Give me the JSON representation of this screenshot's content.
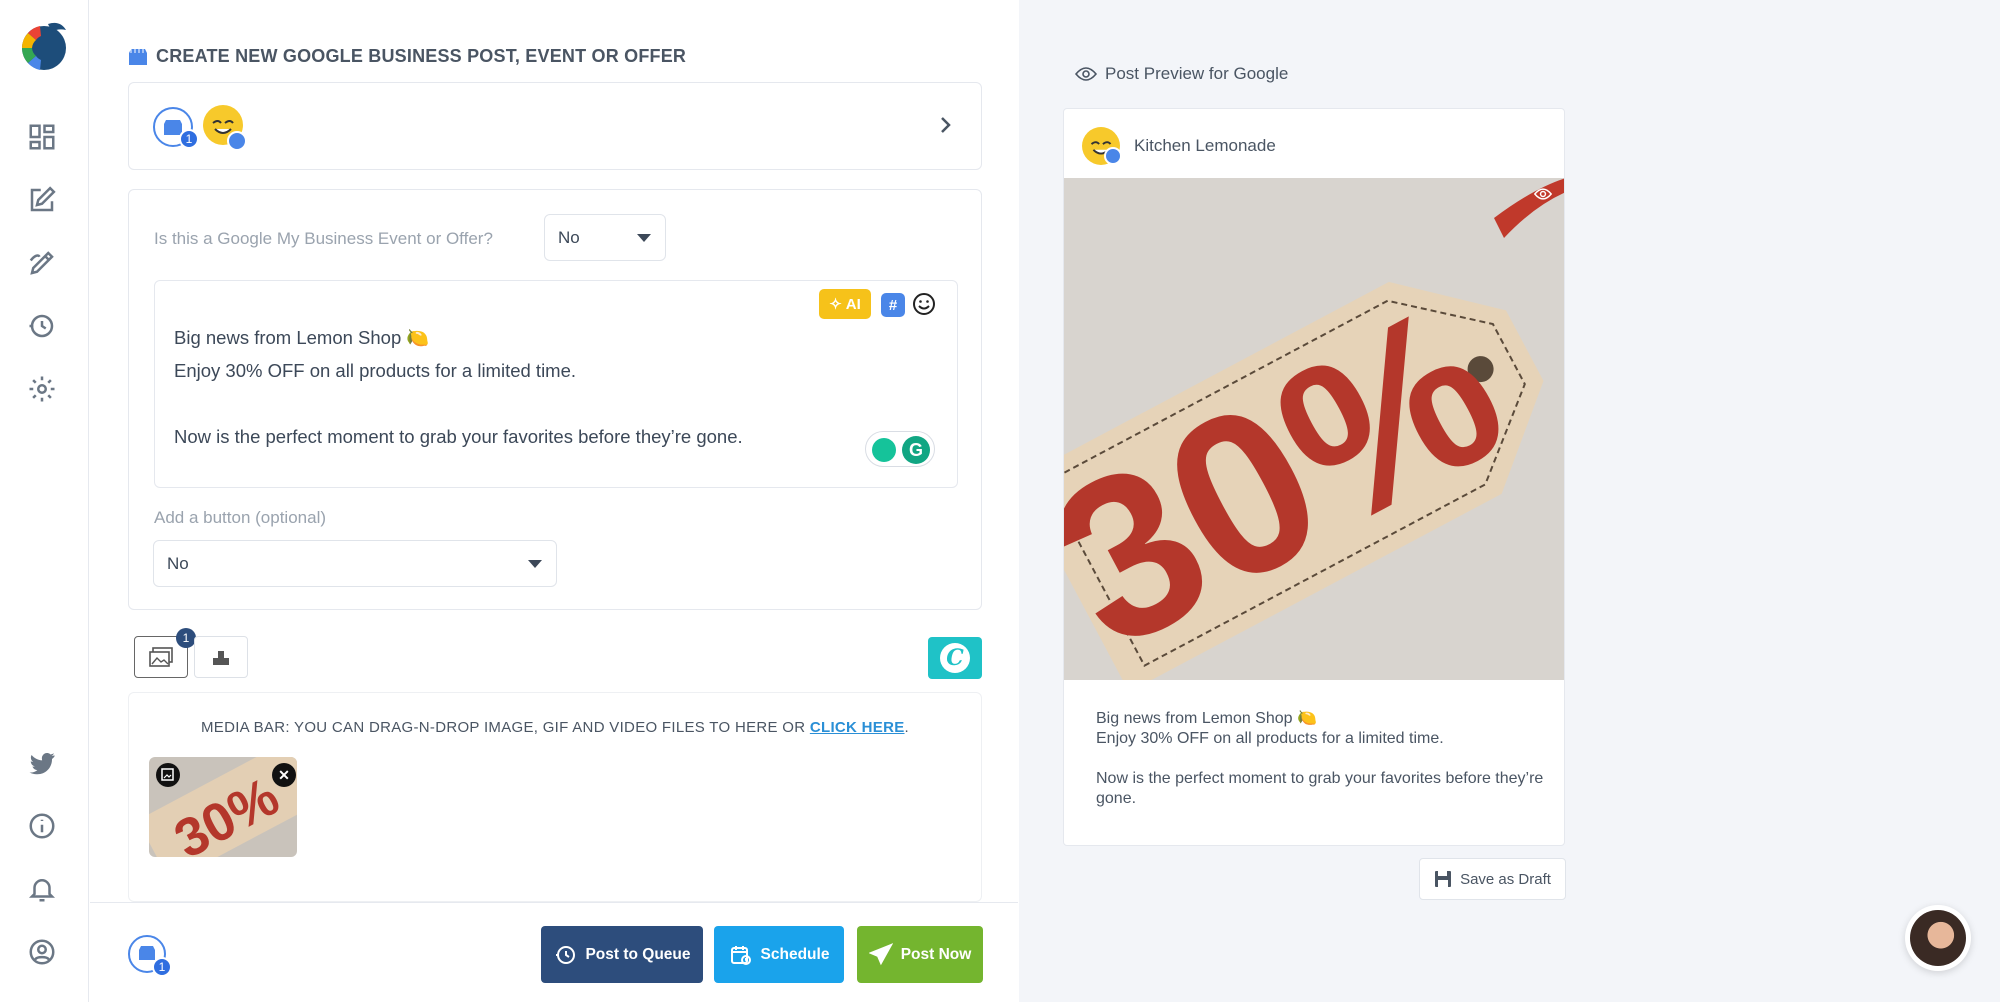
{
  "nav": {
    "items": [
      "dashboard-icon",
      "compose-icon",
      "drafts-icon",
      "queue-icon",
      "settings-icon"
    ],
    "bottom_items": [
      "twitter-icon",
      "info-icon",
      "bell-icon",
      "user-icon"
    ]
  },
  "editor": {
    "title": "CREATE NEW GOOGLE BUSINESS POST, EVENT OR OFFER",
    "accounts": {
      "gmb_count": "1"
    },
    "event_question": "Is this a Google My Business Event or Offer?",
    "event_value": "No",
    "ai_label": "AI",
    "hashtag_label": "#",
    "text_lines": [
      "Big news from Lemon Shop 🍋",
      "Enjoy 30% OFF on all products for a limited time.",
      "",
      "Now is the perfect moment to grab your favorites before they’re gone."
    ],
    "grammarly_label": "G",
    "button_label": "Add a button (optional)",
    "button_value": "No",
    "media_count": "1",
    "canva_label": "C",
    "media_bar_text": "MEDIA BAR: YOU CAN DRAG-N-DROP IMAGE, GIF AND VIDEO FILES TO HERE OR ",
    "media_bar_link": "CLICK HERE",
    "media_bar_end": ".",
    "thumb_remove": "✕"
  },
  "footer": {
    "account_count": "1",
    "post_to_queue": "Post to Queue",
    "schedule": "Schedule",
    "post_now": "Post Now"
  },
  "preview": {
    "title": "Post Preview for Google",
    "account_name": "Kitchen Lemonade",
    "image_text": "30%",
    "text_lines": [
      "Big news from Lemon Shop 🍋",
      "Enjoy 30% OFF on all products for a limited time.",
      "",
      "Now is the perfect moment to grab your favorites before they’re gone."
    ],
    "save_draft": "Save as Draft"
  },
  "colors": {
    "queue": "#2d4d7c",
    "schedule": "#1aa3eb",
    "post_now": "#74b52f",
    "ai": "#f6c21a",
    "canva": "#1fc2c7",
    "link": "#2a8fd6"
  }
}
